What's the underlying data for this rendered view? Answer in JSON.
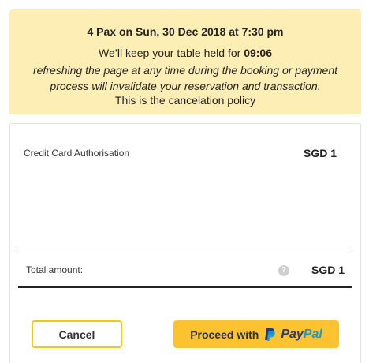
{
  "notice": {
    "title": "4 Pax on Sun, 30 Dec 2018 at 7:30 pm",
    "hold_prefix": "We’ll keep your table held for",
    "hold_timer": "09:06",
    "warning_line1": "refreshing the page at any time during the booking or payment",
    "warning_line2": "process will invalidate your reservation and transaction.",
    "policy": "This is the cancelation policy"
  },
  "summary": {
    "item_label": "Credit Card Authorisation",
    "item_amount": "SGD 1",
    "total_label": "Total amount:",
    "help_icon": "?",
    "total_amount": "SGD 1"
  },
  "actions": {
    "cancel_label": "Cancel",
    "paypal_prefix": "Proceed with",
    "paypal_brand_pay": "Pay",
    "paypal_brand_pal": "Pal"
  },
  "colors": {
    "notice_bg": "#fdeeb5",
    "accent_yellow": "#f5c518",
    "paypal_button": "#fcc230",
    "paypal_dark_blue": "#253b80",
    "paypal_light_blue": "#179bd7"
  },
  "icons": {
    "help": "question-circle-icon",
    "paypal": "paypal-logo-icon"
  }
}
